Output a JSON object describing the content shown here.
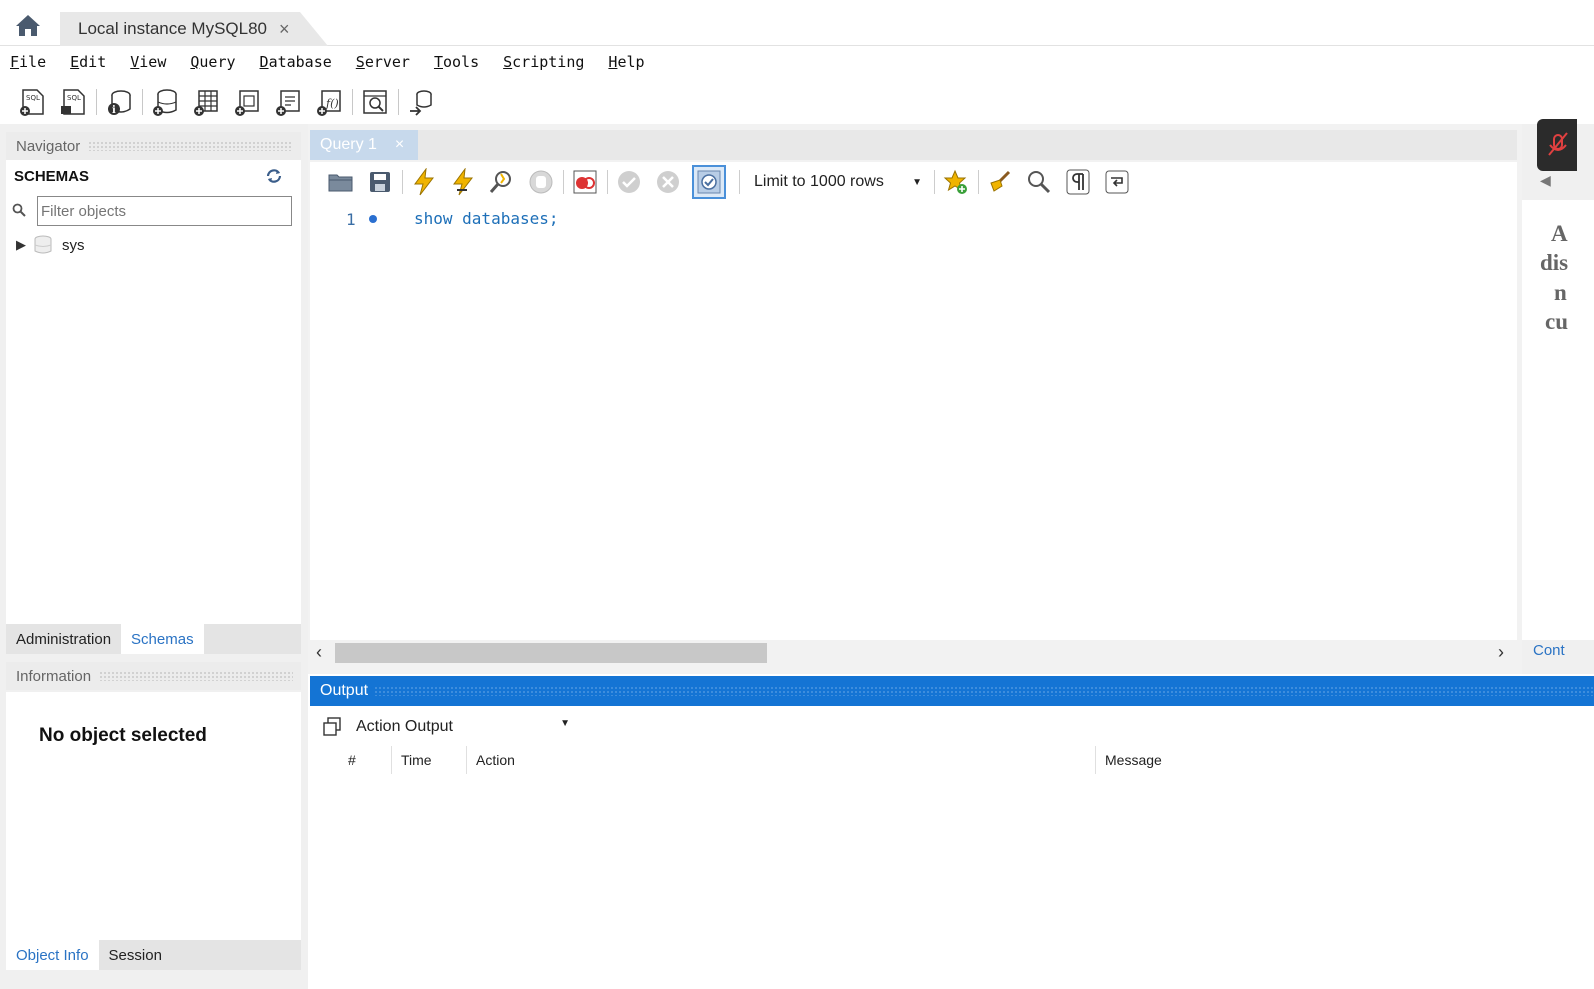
{
  "window": {
    "instance_tab_label": "Local instance MySQL80",
    "tab_close_glyph": "×"
  },
  "menu": [
    {
      "u": "F",
      "rest": "ile"
    },
    {
      "u": "E",
      "rest": "dit"
    },
    {
      "u": "V",
      "rest": "iew"
    },
    {
      "u": "Q",
      "rest": "uery"
    },
    {
      "u": "D",
      "rest": "atabase"
    },
    {
      "u": "S",
      "rest": "erver"
    },
    {
      "u": "T",
      "rest": "ools"
    },
    {
      "u": "S",
      "rest": "cripting"
    },
    {
      "u": "H",
      "rest": "elp"
    }
  ],
  "navigator": {
    "title": "Navigator",
    "schemas_label": "SCHEMAS",
    "filter_placeholder": "Filter objects",
    "tree": [
      {
        "label": "sys"
      }
    ],
    "tabs": {
      "administration": "Administration",
      "schemas": "Schemas"
    }
  },
  "information": {
    "title": "Information",
    "empty_text": "No object selected",
    "tabs": {
      "object_info": "Object Info",
      "session": "Session"
    }
  },
  "editor": {
    "tab_label": "Query 1",
    "tab_close_glyph": "×",
    "limit_label": "Limit to 1000 rows",
    "line_number": "1",
    "code": "show databases;"
  },
  "right_panel": {
    "text_lines": [
      "A",
      "dis",
      "n",
      "cu"
    ],
    "link_text": "Cont"
  },
  "output": {
    "title": "Output",
    "select_value": "Action Output",
    "columns": {
      "num": "#",
      "time": "Time",
      "action": "Action",
      "message": "Message"
    }
  },
  "colors": {
    "accent": "#1474d4",
    "link": "#2a73c4"
  }
}
